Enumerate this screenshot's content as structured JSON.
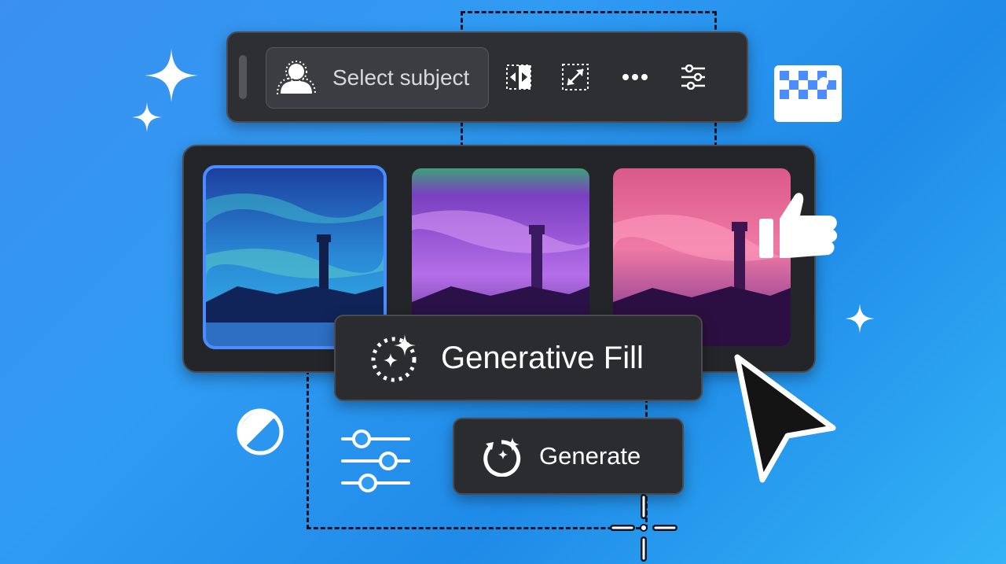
{
  "toolbar": {
    "select_subject_label": "Select subject",
    "icons": [
      "select-subject-icon",
      "invert-selection-icon",
      "expand-selection-icon",
      "more-icon",
      "sliders-icon"
    ]
  },
  "gallery": {
    "variations": [
      {
        "name": "variation-blue",
        "selected": true
      },
      {
        "name": "variation-purple",
        "selected": false
      },
      {
        "name": "variation-pink",
        "selected": false
      }
    ]
  },
  "actions": {
    "generative_fill_label": "Generative Fill",
    "generate_label": "Generate"
  },
  "colors": {
    "background": "#2f9bf3",
    "panel": "#2e2f33",
    "selected_outline": "#4b8dff",
    "icon": "#ffffff"
  }
}
